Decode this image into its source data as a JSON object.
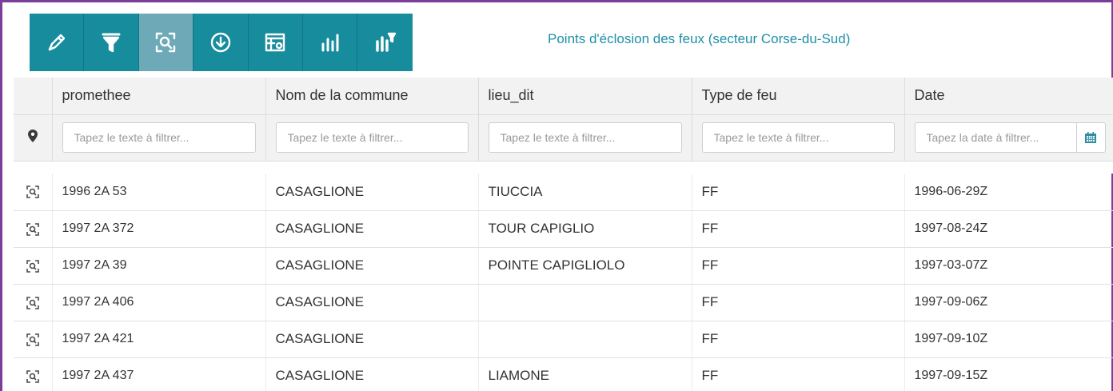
{
  "title": "Points d'éclosion des feux (secteur Corse-du-Sud)",
  "toolbar": {
    "tools": [
      {
        "icon": "pencil-icon"
      },
      {
        "icon": "filter-icon"
      },
      {
        "icon": "zoom-extent-icon",
        "active": true
      },
      {
        "icon": "download-icon"
      },
      {
        "icon": "table-settings-icon"
      },
      {
        "icon": "bar-chart-icon"
      },
      {
        "icon": "chart-filter-icon"
      }
    ]
  },
  "colors": {
    "toolbar_bg": "#168c9c",
    "toolbar_active": "#6ea9b7",
    "title": "#1f8fa8",
    "frame": "#7a3d9a"
  },
  "table": {
    "columns": [
      "promethee",
      "Nom de la commune",
      "lieu_dit",
      "Type de feu",
      "Date"
    ],
    "filter_placeholders": [
      "Tapez le texte à filtrer...",
      "Tapez le texte à filtrer...",
      "Tapez le texte à filtrer...",
      "Tapez le texte à filtrer...",
      "Tapez la date à filtrer..."
    ],
    "rows": [
      {
        "promethee": "1996 2A 53",
        "commune": "CASAGLIONE",
        "lieu_dit": "TIUCCIA",
        "type": "FF",
        "date": "1996-06-29Z"
      },
      {
        "promethee": "1997 2A 372",
        "commune": "CASAGLIONE",
        "lieu_dit": "TOUR CAPIGLIO",
        "type": "FF",
        "date": "1997-08-24Z"
      },
      {
        "promethee": "1997 2A 39",
        "commune": "CASAGLIONE",
        "lieu_dit": "POINTE CAPIGLIOLO",
        "type": "FF",
        "date": "1997-03-07Z"
      },
      {
        "promethee": "1997 2A 406",
        "commune": "CASAGLIONE",
        "lieu_dit": "",
        "type": "FF",
        "date": "1997-09-06Z"
      },
      {
        "promethee": "1997 2A 421",
        "commune": "CASAGLIONE",
        "lieu_dit": "",
        "type": "FF",
        "date": "1997-09-10Z"
      },
      {
        "promethee": "1997 2A 437",
        "commune": "CASAGLIONE",
        "lieu_dit": "LIAMONE",
        "type": "FF",
        "date": "1997-09-15Z"
      }
    ]
  }
}
